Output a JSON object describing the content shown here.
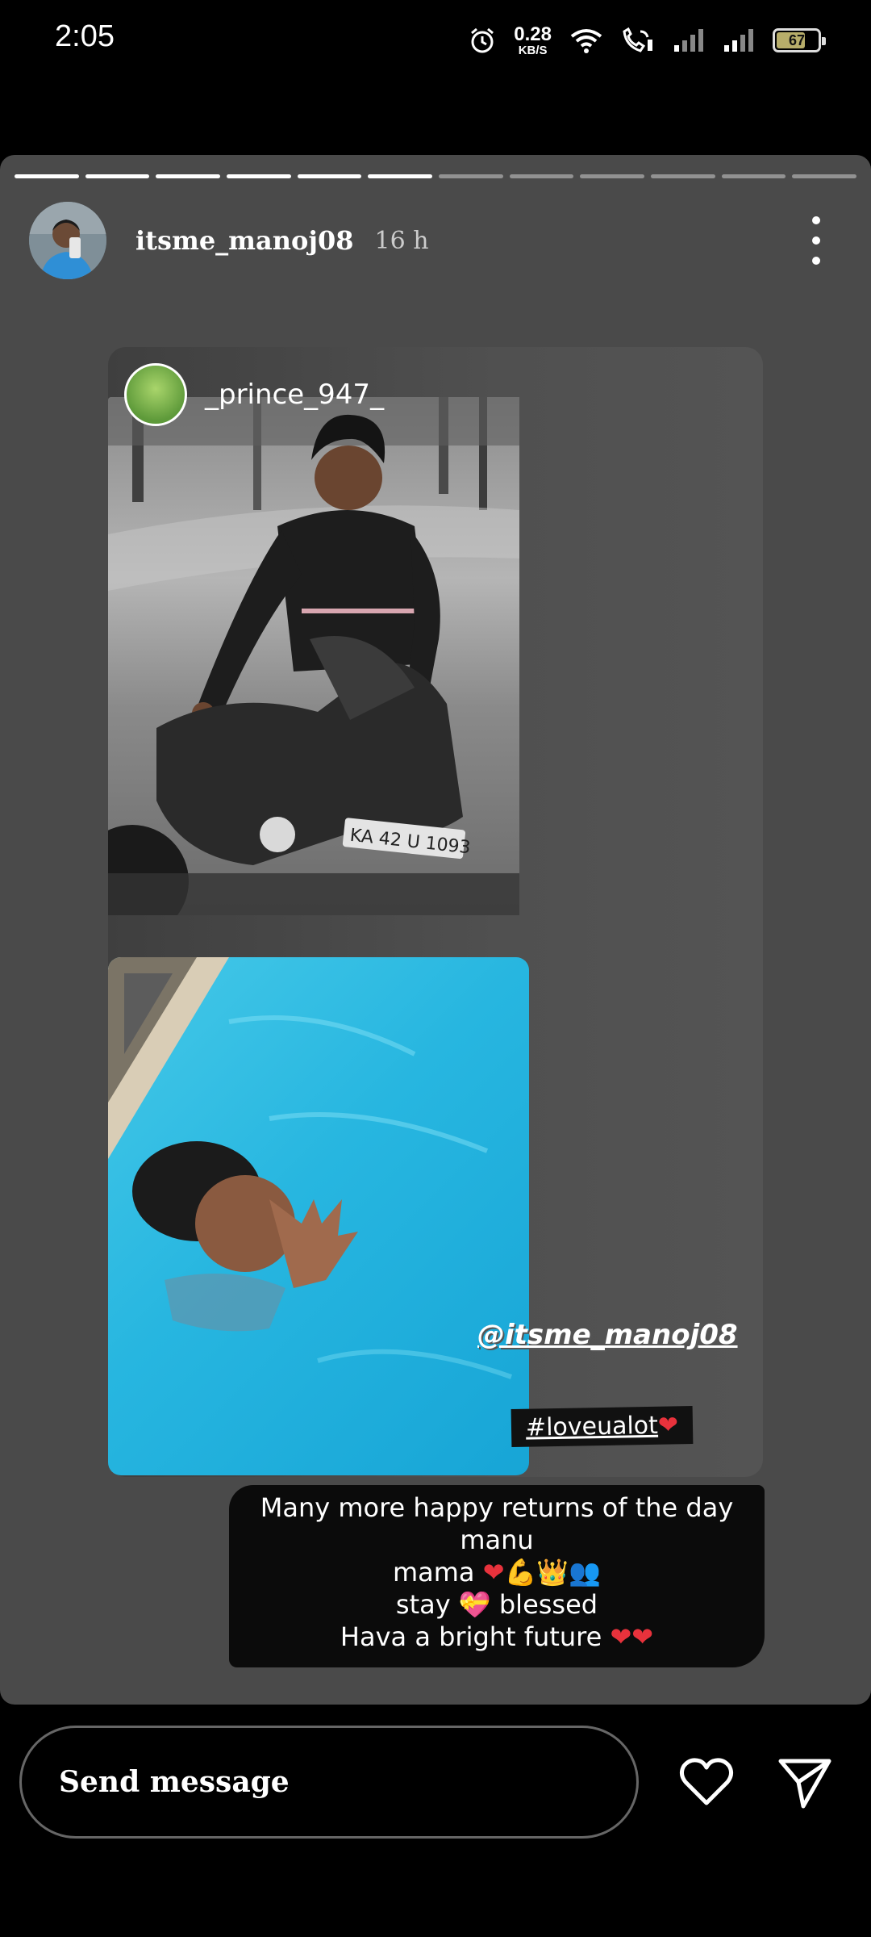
{
  "status_bar": {
    "time": "2:05",
    "net_speed_value": "0.28",
    "net_speed_unit": "KB/S",
    "battery": "67",
    "icons": [
      "alarm-icon",
      "wifi-icon",
      "wifi-calling-icon",
      "signal-icon",
      "signal-icon",
      "battery-icon"
    ]
  },
  "story": {
    "progress": {
      "total": 12,
      "viewed": 6
    },
    "username": "itsme_manoj08",
    "time_ago": "16 h",
    "shared_post": {
      "author": "_prince_947_"
    },
    "mention": "@itsme_manoj08",
    "hashtag": "#loveualot",
    "caption": {
      "line1": "Many more happy returns of the day manu",
      "line2": "mama",
      "line3a": "stay",
      "line3b": "blessed",
      "line4": "Hava a bright future"
    },
    "plate_text": "KA 42 U 1093"
  },
  "bottom_bar": {
    "message_placeholder": "Send message"
  },
  "colors": {
    "story_bg": "#4a4a4a",
    "heart_red": "#e8323c",
    "pool_blue": "#27b6e0"
  }
}
